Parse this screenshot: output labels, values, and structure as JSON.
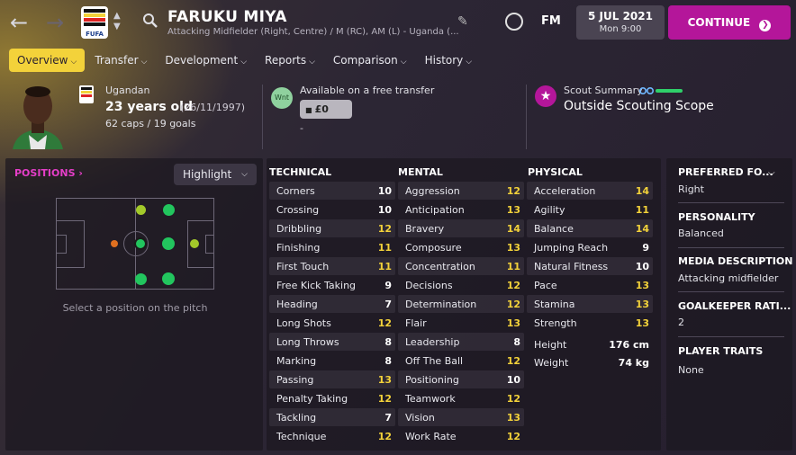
{
  "header": {
    "player_name": "FARUKU MIYA",
    "player_desc": "Attacking Midfielder (Right, Centre) / M (RC), AM (L) - Uganda (...",
    "badge_text": "FUFA",
    "fm_label": "FM",
    "date": "5 JUL 2021",
    "time": "Mon 9:00",
    "continue_label": "CONTINUE"
  },
  "tabs": [
    {
      "label": "Overview",
      "active": true
    },
    {
      "label": "Transfer"
    },
    {
      "label": "Development"
    },
    {
      "label": "Reports"
    },
    {
      "label": "Comparison"
    },
    {
      "label": "History"
    }
  ],
  "bio": {
    "nationality": "Ugandan",
    "age": "23 years old",
    "dob": "(26/11/1997)",
    "caps": "62 caps / 19 goals"
  },
  "transfer": {
    "badge": "Wnt",
    "status": "Available on a free transfer",
    "fee": "£0",
    "extra": "-"
  },
  "scout": {
    "title": "Scout Summary",
    "value": "Outside Scouting Scope"
  },
  "positions": {
    "title": "POSITIONS",
    "highlight_label": "Highlight",
    "hint": "Select a position on the pitch"
  },
  "technical": {
    "title": "TECHNICAL",
    "rows": [
      {
        "name": "Corners",
        "value": "10"
      },
      {
        "name": "Crossing",
        "value": "10"
      },
      {
        "name": "Dribbling",
        "value": "12"
      },
      {
        "name": "Finishing",
        "value": "11"
      },
      {
        "name": "First Touch",
        "value": "11"
      },
      {
        "name": "Free Kick Taking",
        "value": "9"
      },
      {
        "name": "Heading",
        "value": "7"
      },
      {
        "name": "Long Shots",
        "value": "12"
      },
      {
        "name": "Long Throws",
        "value": "8"
      },
      {
        "name": "Marking",
        "value": "8"
      },
      {
        "name": "Passing",
        "value": "13"
      },
      {
        "name": "Penalty Taking",
        "value": "12"
      },
      {
        "name": "Tackling",
        "value": "7"
      },
      {
        "name": "Technique",
        "value": "12"
      }
    ]
  },
  "mental": {
    "title": "MENTAL",
    "rows": [
      {
        "name": "Aggression",
        "value": "12"
      },
      {
        "name": "Anticipation",
        "value": "13"
      },
      {
        "name": "Bravery",
        "value": "14"
      },
      {
        "name": "Composure",
        "value": "13"
      },
      {
        "name": "Concentration",
        "value": "11"
      },
      {
        "name": "Decisions",
        "value": "12"
      },
      {
        "name": "Determination",
        "value": "12"
      },
      {
        "name": "Flair",
        "value": "13"
      },
      {
        "name": "Leadership",
        "value": "8"
      },
      {
        "name": "Off The Ball",
        "value": "12"
      },
      {
        "name": "Positioning",
        "value": "10"
      },
      {
        "name": "Teamwork",
        "value": "12"
      },
      {
        "name": "Vision",
        "value": "13"
      },
      {
        "name": "Work Rate",
        "value": "12"
      }
    ]
  },
  "physical": {
    "title": "PHYSICAL",
    "rows": [
      {
        "name": "Acceleration",
        "value": "14"
      },
      {
        "name": "Agility",
        "value": "11"
      },
      {
        "name": "Balance",
        "value": "14"
      },
      {
        "name": "Jumping Reach",
        "value": "9"
      },
      {
        "name": "Natural Fitness",
        "value": "10"
      },
      {
        "name": "Pace",
        "value": "13"
      },
      {
        "name": "Stamina",
        "value": "13"
      },
      {
        "name": "Strength",
        "value": "13"
      }
    ],
    "height_label": "Height",
    "height_value": "176 cm",
    "weight_label": "Weight",
    "weight_value": "74 kg"
  },
  "side": {
    "preferred_foot_title": "PREFERRED FO...",
    "preferred_foot": "Right",
    "personality_title": "PERSONALITY",
    "personality": "Balanced",
    "media_title": "MEDIA DESCRIPTION",
    "media": "Attacking midfielder",
    "gk_title": "GOALKEEPER RATI...",
    "gk": "2",
    "traits_title": "PLAYER TRAITS",
    "traits": "None"
  },
  "colors": {
    "accent": "#b4169a",
    "tab_active": "#f3d23a",
    "value_high": "#f3d23a",
    "pos_natural": "#22c55e",
    "pos_accomplished": "#a3c92a",
    "pos_unconvincing": "#e07020"
  }
}
